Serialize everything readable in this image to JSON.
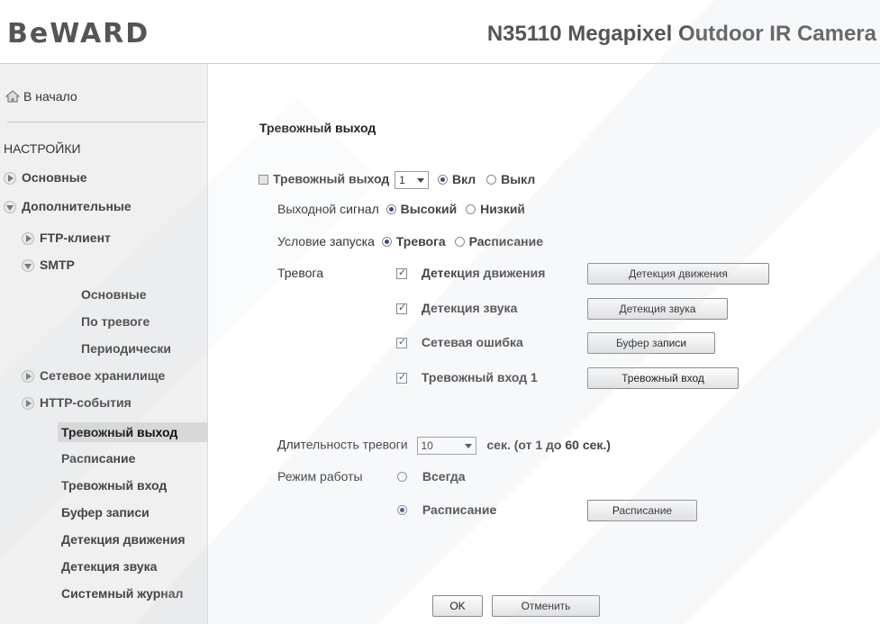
{
  "header": {
    "logo": "BeWARD",
    "model": "N35110 Megapixel Outdoor IR Camera"
  },
  "sidebar": {
    "home_label": "В начало",
    "settings_heading": "НАСТРОЙКИ",
    "items": {
      "basic": "Основные",
      "advanced": "Дополнительные",
      "ftp": "FTP-клиент",
      "smtp": "SMTP",
      "smtp_basic": "Основные",
      "smtp_alarm": "По тревоге",
      "smtp_periodic": "Периодически",
      "nas": "Сетевое хранилище",
      "http_events": "HTTP-события",
      "alarm_output": "Тревожный выход",
      "schedule": "Расписание",
      "alarm_input": "Тревожный вход",
      "record_buffer": "Буфер записи",
      "motion_detection": "Детекция движения",
      "audio_detection": "Детекция звука",
      "system_log": "Системный журнал"
    }
  },
  "main": {
    "section_title": "Тревожный выход",
    "alarm_output_label": "Тревожный выход",
    "alarm_output_select": "1",
    "on_label": "Вкл",
    "off_label": "Выкл",
    "output_signal_label": "Выходной сигнал",
    "high_label": "Высокий",
    "low_label": "Низкий",
    "trigger_label": "Условие запуска",
    "trigger_alarm": "Тревога",
    "trigger_schedule": "Расписание",
    "alarm_label": "Тревога",
    "alarms": {
      "motion": {
        "label": "Детекция движения",
        "button": "Детекция движения"
      },
      "audio": {
        "label": "Детекция звука",
        "button": "Детекция звука"
      },
      "network": {
        "label": "Сетевая ошибка",
        "button": "Буфер записи"
      },
      "input": {
        "label": "Тревожный вход 1",
        "button": "Тревожный вход"
      }
    },
    "duration_label": "Длительность тревоги",
    "duration_value": "10",
    "duration_hint": "сек. (от 1 до 60 сек.)",
    "mode_label": "Режим работы",
    "mode_always": "Всегда",
    "mode_schedule": "Расписание",
    "schedule_button": "Расписание",
    "ok_button": "OK",
    "cancel_button": "Отменить"
  }
}
